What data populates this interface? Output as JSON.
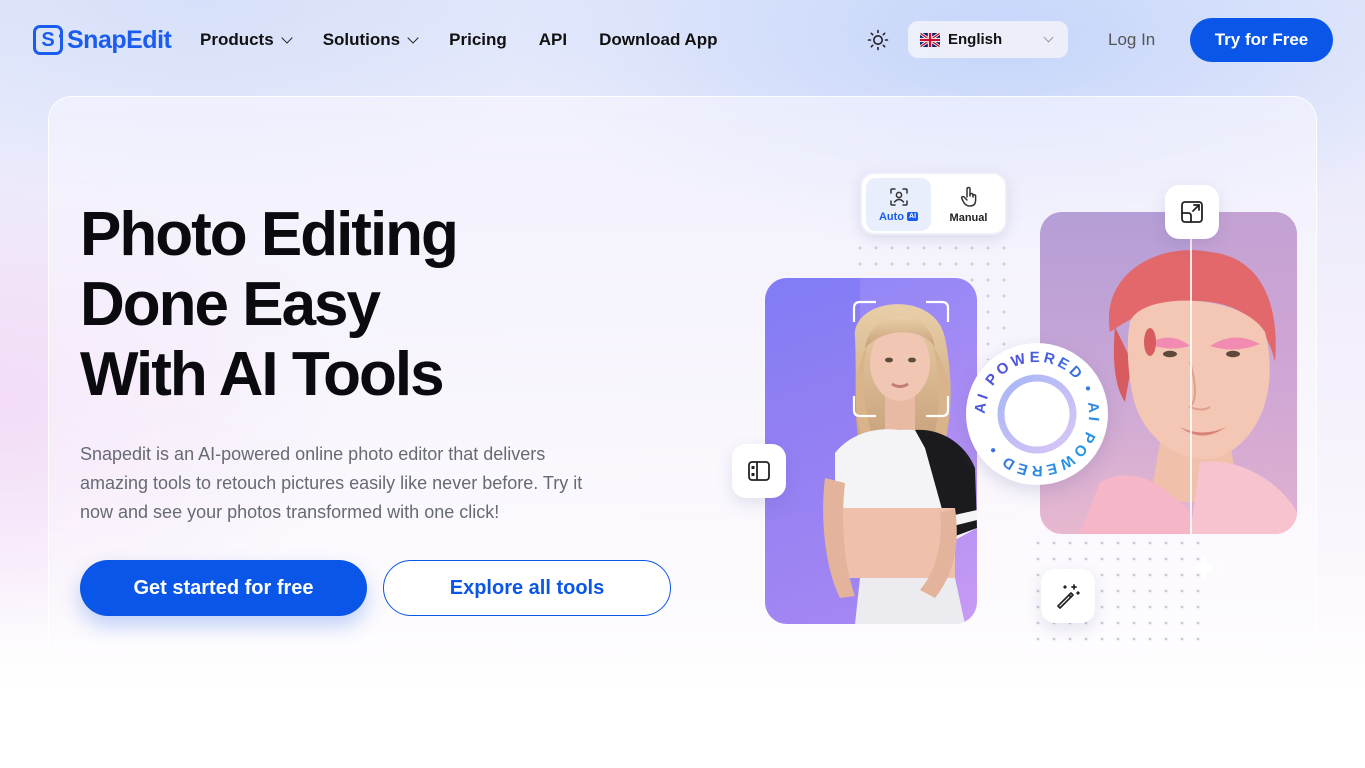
{
  "brand": {
    "logo_letter": "S",
    "name": "SnapEdit"
  },
  "nav": {
    "items": [
      {
        "label": "Products",
        "has_dropdown": true
      },
      {
        "label": "Solutions",
        "has_dropdown": true
      },
      {
        "label": "Pricing",
        "has_dropdown": false
      },
      {
        "label": "API",
        "has_dropdown": false
      },
      {
        "label": "Download App",
        "has_dropdown": false
      }
    ],
    "theme_icon": "sun-icon",
    "language": {
      "selected": "English",
      "flag": "uk-flag-icon"
    },
    "login_label": "Log In",
    "cta_label": "Try for Free"
  },
  "hero": {
    "headline": [
      "Photo Editing",
      "Done Easy",
      "With AI Tools"
    ],
    "subtitle": "Snapedit is an AI-powered online photo editor that delivers amazing tools to retouch pictures easily like never before. Try it now and see your photos transformed with one click!",
    "primary_cta": "Get started for free",
    "secondary_cta": "Explore all tools"
  },
  "illustration": {
    "mode_toggle": {
      "auto_label": "Auto",
      "auto_badge": "AI",
      "manual_label": "Manual",
      "selected": "Auto"
    },
    "badge_text": "AI POWERED • AI POWERED •",
    "icons": [
      "compare-icon",
      "expand-icon",
      "magic-wand-icon",
      "sparkle-icon"
    ]
  },
  "colors": {
    "brand_blue": "#0a56e8",
    "headline": "#0b0b0f",
    "subtitle": "#666a73"
  }
}
